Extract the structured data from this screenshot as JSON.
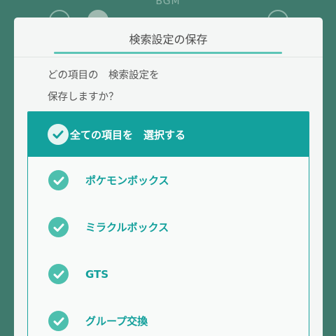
{
  "background": {
    "partial_label": "BGM"
  },
  "dialog": {
    "title": "検索設定の保存",
    "prompt_line1": "どの項目の　検索設定を",
    "prompt_line2": "保存しますか？",
    "select_all": {
      "label": "全ての項目を　選択する",
      "checked": true
    },
    "items": [
      {
        "label": "ポケモンボックス",
        "checked": true
      },
      {
        "label": "ミラクルボックス",
        "checked": true
      },
      {
        "label": "GTS",
        "checked": true
      },
      {
        "label": "グループ交換",
        "checked": true
      }
    ]
  },
  "colors": {
    "background": "#3f7a6d",
    "accent": "#13a19d",
    "check": "#4dbfae",
    "label_text": "#14a09c"
  }
}
